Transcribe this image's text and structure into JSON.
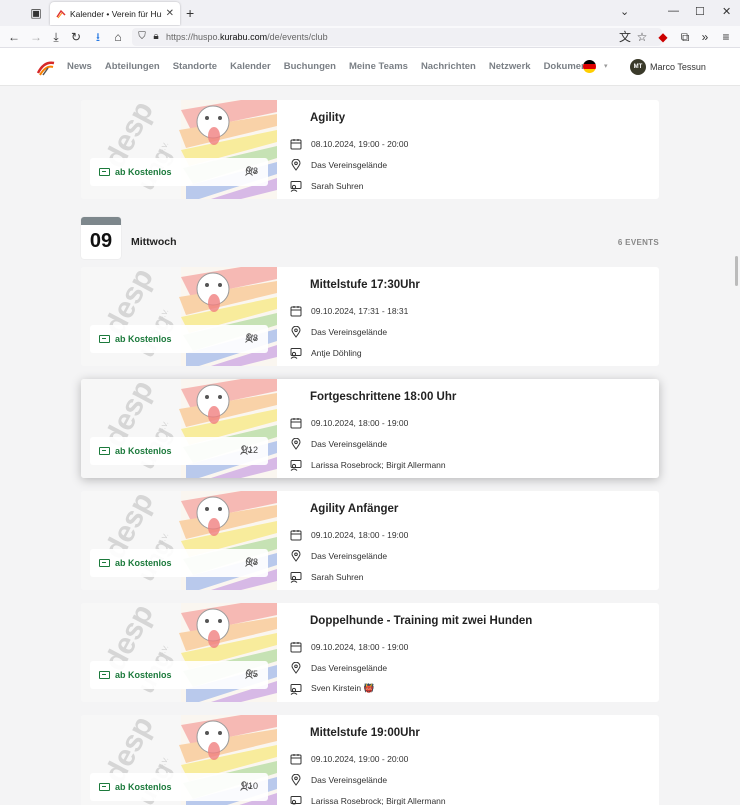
{
  "browser": {
    "tab_title": "Kalender • Verein für Hundesp",
    "url_prefix": "https://huspo.",
    "url_domain": "kurabu.com",
    "url_path": "/de/events/club"
  },
  "site": {
    "menu": [
      "News",
      "Abteilungen",
      "Standorte",
      "Kalender",
      "Buchungen",
      "Meine Teams",
      "Nachrichten",
      "Netzwerk",
      "Dokumente"
    ],
    "user": {
      "initials": "MT",
      "name": "Marco Tessun"
    }
  },
  "prev_event": {
    "title": "Agility",
    "date": "08.10.2024, 19:00 - 20:00",
    "location": "Das Vereinsgelände",
    "trainer": "Sarah Suhren",
    "price": "ab Kostenlos",
    "spots": "0/8"
  },
  "day": {
    "number": "09",
    "name": "Mittwoch",
    "count": "6 EVENTS"
  },
  "events": [
    {
      "title": "Mittelstufe 17:30Uhr",
      "date": "09.10.2024, 17:31 - 18:31",
      "location": "Das Vereinsgelände",
      "trainer": "Antje Döhling",
      "price": "ab Kostenlos",
      "spots": "4/8"
    },
    {
      "title": "Fortgeschrittene 18:00 Uhr",
      "date": "09.10.2024, 18:00 - 19:00",
      "location": "Das Vereinsgelände",
      "trainer": "Larissa Rosebrock; Birgit Allermann",
      "price": "ab Kostenlos",
      "spots": "1/12"
    },
    {
      "title": "Agility Anfänger",
      "date": "09.10.2024, 18:00 - 19:00",
      "location": "Das Vereinsgelände",
      "trainer": "Sarah Suhren",
      "price": "ab Kostenlos",
      "spots": "0/8"
    },
    {
      "title": "Doppelhunde - Training mit zwei Hunden",
      "date": "09.10.2024, 18:00 - 19:00",
      "location": "Das Vereinsgelände",
      "trainer": "Sven Kirstein 👹",
      "price": "ab Kostenlos",
      "spots": "0/5"
    },
    {
      "title": "Mittelstufe 19:00Uhr",
      "date": "09.10.2024, 19:00 - 20:00",
      "location": "Das Vereinsgelände",
      "trainer": "Larissa Rosebrock; Birgit Allermann",
      "price": "ab Kostenlos",
      "spots": "1/10"
    }
  ]
}
